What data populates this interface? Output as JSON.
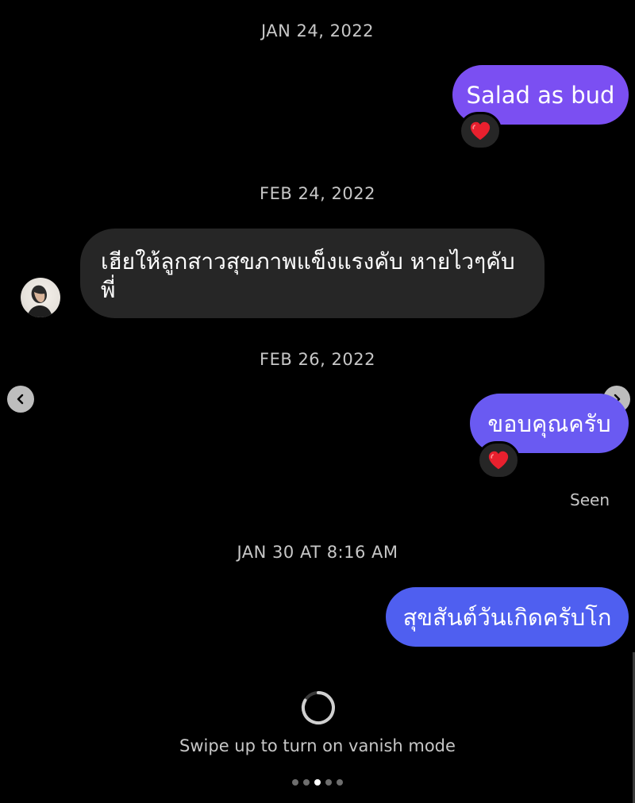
{
  "colors": {
    "outgoing_purple": "#7b4ff2",
    "outgoing_violet": "#6a5af2",
    "outgoing_blue": "#4f5ff0",
    "incoming_bg": "#262626",
    "heart": "#e8202e"
  },
  "dates": {
    "d1": "JAN 24, 2022",
    "d2": "FEB 24, 2022",
    "d3": "FEB 26, 2022",
    "d4": "JAN 30 AT 8:16 AM"
  },
  "messages": {
    "m1": {
      "text": "Salad as bud",
      "reaction": "heart-emoji"
    },
    "m2": {
      "text": "เฮียให้ลูกสาวสุขภาพแข็งแรงคับ หายไวๆคับพี่",
      "avatar": "contact-avatar"
    },
    "m3": {
      "text": "ขอบคุณครับ",
      "reaction": "heart-emoji"
    },
    "m4": {
      "text": "สุขสันต์วันเกิดครับโก"
    }
  },
  "status": {
    "seen": "Seen"
  },
  "footer": {
    "vanish_text": "Swipe up to turn on vanish mode",
    "spinner_icon": "loading-spinner-icon",
    "page_dots": {
      "count": 5,
      "active_index": 2
    }
  },
  "nav": {
    "prev_icon": "chevron-left-icon",
    "next_icon": "chevron-right-icon"
  }
}
